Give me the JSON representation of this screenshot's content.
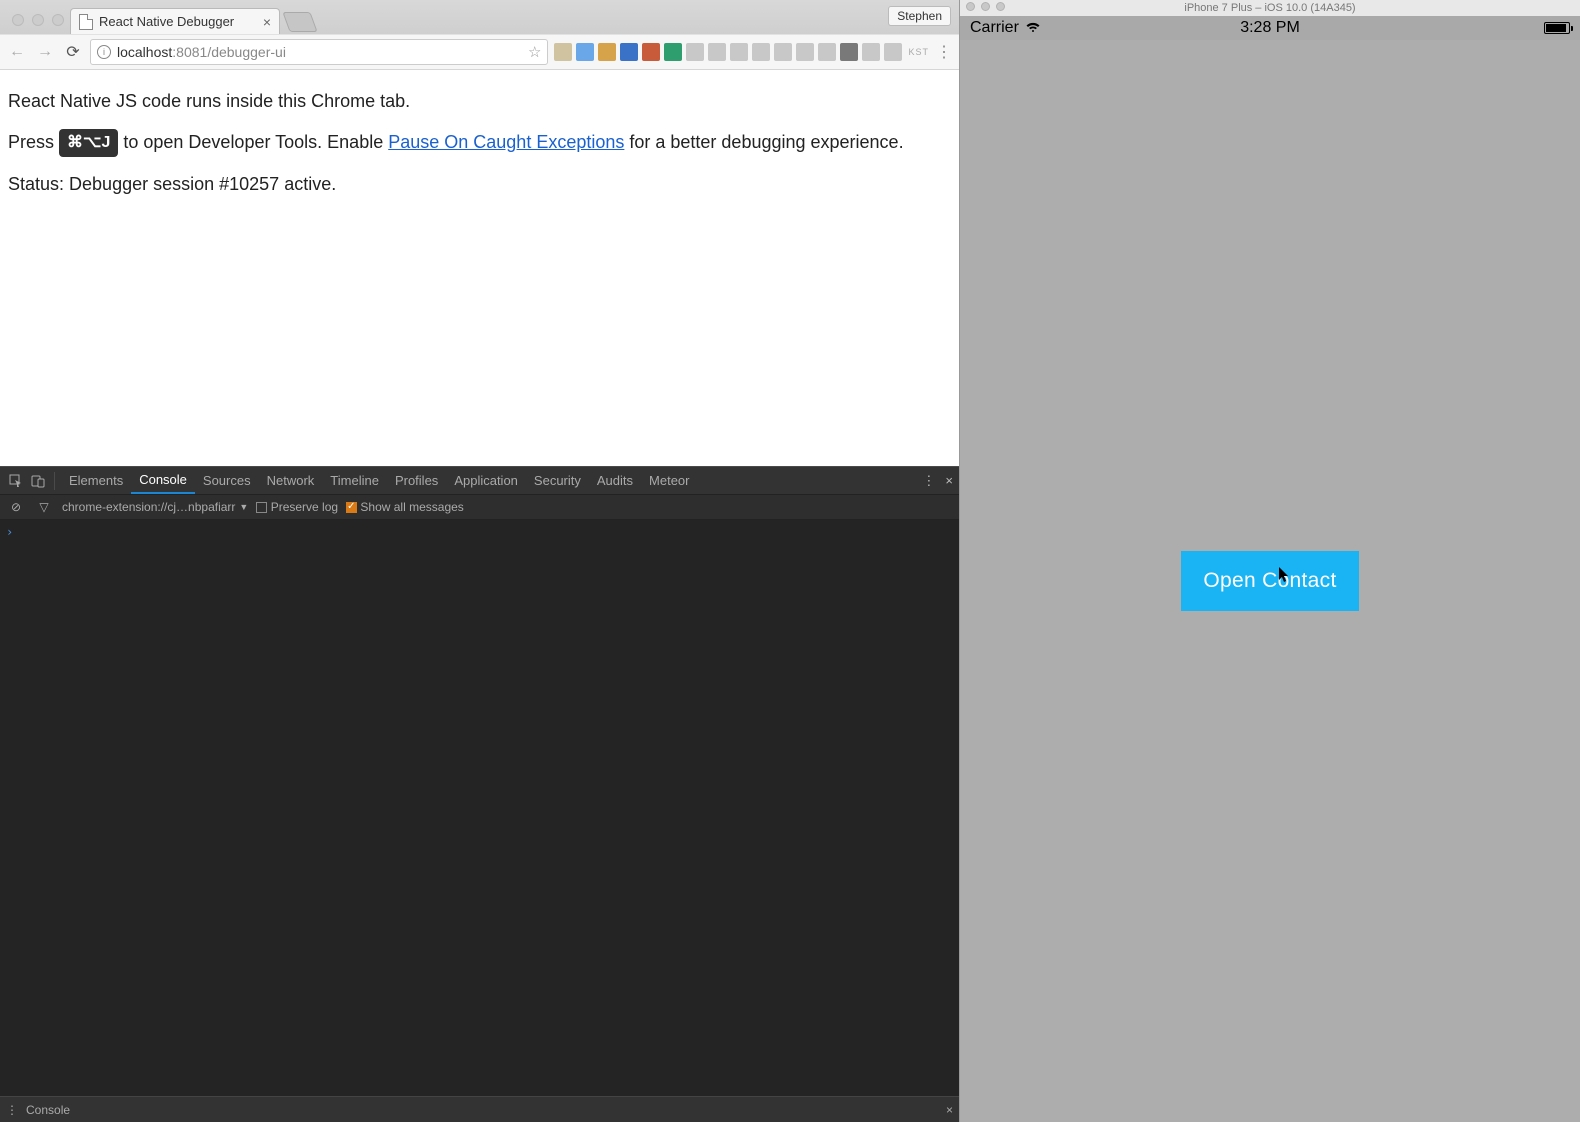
{
  "chrome": {
    "tab_title": "React Native Debugger",
    "user_chip": "Stephen",
    "url_host": "localhost",
    "url_port": ":8081",
    "url_path": "/debugger-ui",
    "extensions_semantic": [
      "ext1",
      "ext2",
      "ext3",
      "om",
      "ublock",
      "ext6",
      "ext7",
      "w",
      "ext9",
      "ext10",
      "ext11",
      "ext12",
      "ext13",
      "es",
      "ext15",
      "ext16"
    ],
    "ext_colors": [
      "#d0c4a0",
      "#6aa7e8",
      "#d6a24a",
      "#3a72c8",
      "#c85c3a",
      "#2f9e6f",
      "#c8c8c8",
      "#c8c8c8",
      "#c8c8c8",
      "#c8c8c8",
      "#c8c8c8",
      "#c8c8c8",
      "#c8c8c8",
      "#797979",
      "#c8c8c8",
      "#c8c8c8"
    ],
    "kst_label": "KST"
  },
  "page": {
    "line1": "React Native JS code runs inside this Chrome tab.",
    "line2a": "Press ",
    "kbd": "⌘⌥J",
    "line2b": " to open Developer Tools. Enable ",
    "link": "Pause On Caught Exceptions",
    "line2c": " for a better debugging experience.",
    "status": "Status: Debugger session #10257 active."
  },
  "devtools": {
    "tabs": [
      "Elements",
      "Console",
      "Sources",
      "Network",
      "Timeline",
      "Profiles",
      "Application",
      "Security",
      "Audits",
      "Meteor"
    ],
    "active_tab": "Console",
    "context": "chrome-extension://cj…nbpafiarr",
    "preserve_log_label": "Preserve log",
    "preserve_log_checked": false,
    "show_all_label": "Show all messages",
    "show_all_checked": true,
    "prompt": "›",
    "drawer_label": "Console"
  },
  "simulator": {
    "title": "iPhone 7 Plus – iOS 10.0 (14A345)",
    "carrier": "Carrier",
    "time": "3:28 PM",
    "button_label": "Open Contact"
  }
}
